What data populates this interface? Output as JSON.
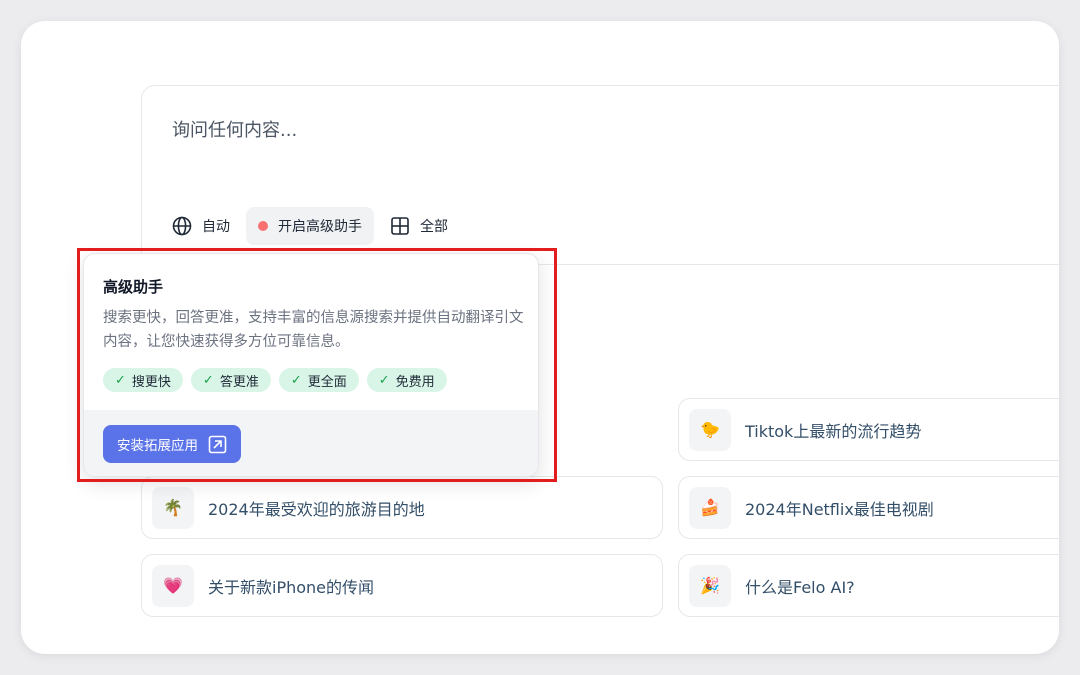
{
  "search": {
    "placeholder": "询问任何内容..."
  },
  "toolbar": {
    "auto_label": "自动",
    "assistant_label": "开启高级助手",
    "all_label": "全部"
  },
  "popup": {
    "title": "高级助手",
    "description": "搜索更快，回答更准，支持丰富的信息源搜索并提供自动翻译引文内容，让您快速获得多方位可靠信息。",
    "tags": [
      "搜更快",
      "答更准",
      "更全面",
      "免费用"
    ],
    "install_label": "安装拓展应用"
  },
  "suggestions": [
    {
      "icon": "tiktok-chick-icon",
      "emoji": "🐤",
      "label": "Tiktok上最新的流行趋势"
    },
    {
      "icon": "palm-tree-icon",
      "emoji": "🌴",
      "label": "2024年最受欢迎的旅游目的地"
    },
    {
      "icon": "cake-icon",
      "emoji": "🍰",
      "label": "2024年Netflix最佳电视剧"
    },
    {
      "icon": "heart-icon",
      "emoji": "💗",
      "label": "关于新款iPhone的传闻"
    },
    {
      "icon": "party-popper-icon",
      "emoji": "🎉",
      "label": "什么是Felo AI?"
    }
  ],
  "colors": {
    "accent": "#5b73e8",
    "tag_bg": "#d9f5e7",
    "highlight": "#e11d1d"
  }
}
